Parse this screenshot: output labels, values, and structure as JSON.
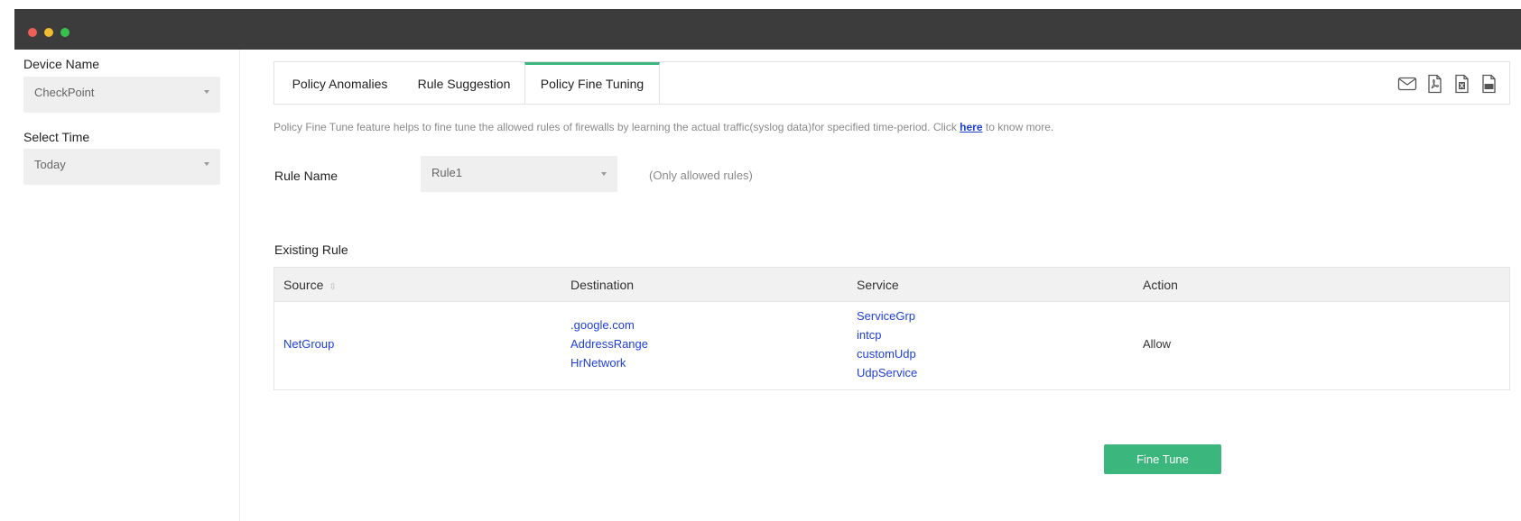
{
  "sidebar": {
    "device_label": "Device Name",
    "device_value": "CheckPoint",
    "time_label": "Select Time",
    "time_value": "Today"
  },
  "tabs": [
    {
      "label": "Policy Anomalies"
    },
    {
      "label": "Rule Suggestion"
    },
    {
      "label": "Policy Fine Tuning",
      "active": true
    }
  ],
  "export_icons": [
    "mail-icon",
    "pdf-icon",
    "excel-icon",
    "csv-icon"
  ],
  "info": {
    "text": "Policy Fine Tune feature helps to fine tune the allowed rules of firewalls by learning the actual traffic(syslog data)for specified time-period. Click",
    "link": "here",
    "suffix": "to know more."
  },
  "rule": {
    "label": "Rule Name",
    "value": "Rule1",
    "note": "(Only allowed rules)"
  },
  "existing_rule": {
    "title": "Existing Rule",
    "columns": [
      "Source",
      "Destination",
      "Service",
      "Action"
    ],
    "row": {
      "source": [
        "NetGroup"
      ],
      "destination": [
        ".google.com",
        "AddressRange",
        "HrNetwork"
      ],
      "service": [
        "ServiceGrp",
        "intcp",
        "customUdp",
        "UdpService"
      ],
      "action": "Allow"
    }
  },
  "fine_tune_button": "Fine Tune",
  "colors": {
    "accent": "#3bb77e",
    "link": "#1f3fd8",
    "titlebar": "#3c3c3c"
  }
}
